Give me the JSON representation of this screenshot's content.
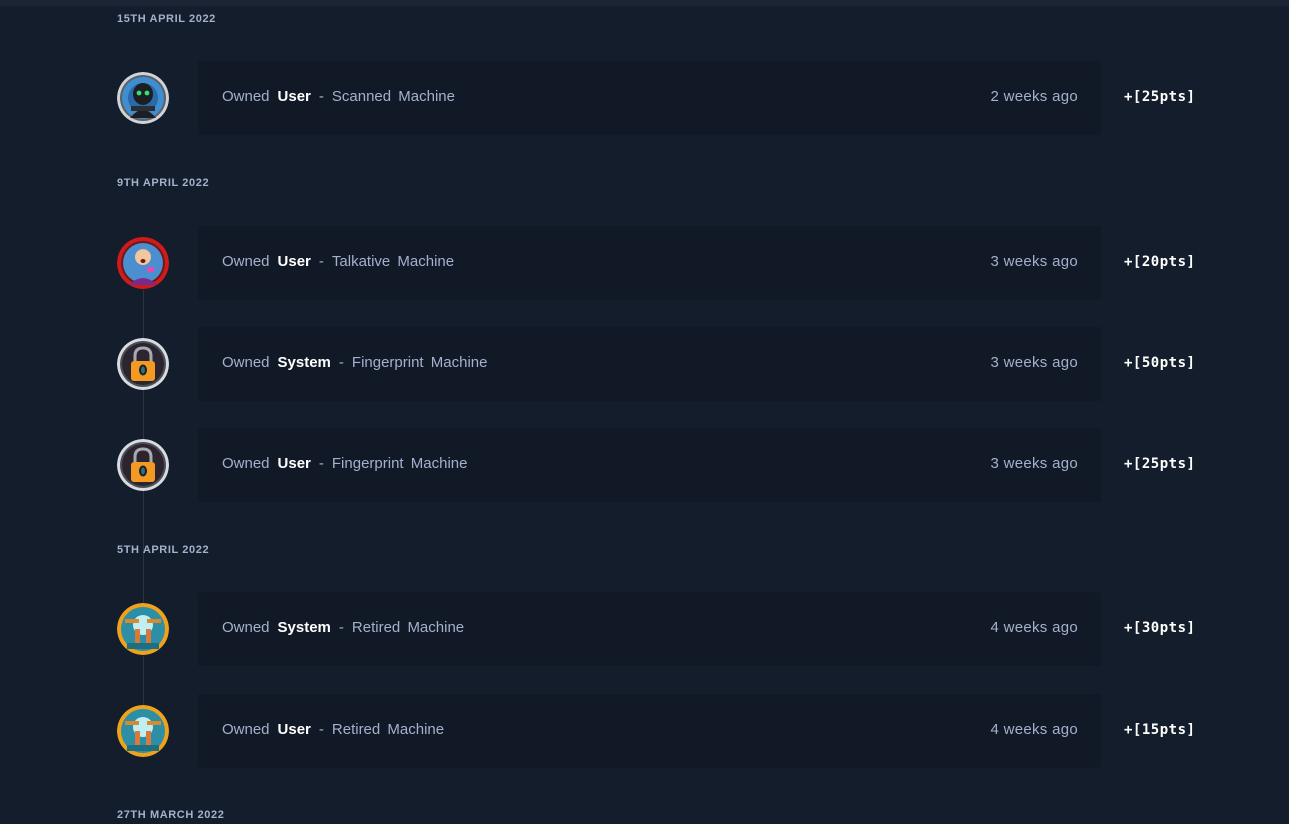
{
  "timeline": {
    "groups": [
      {
        "date": "15TH APRIL 2022",
        "items": [
          {
            "action": "Owned",
            "type": "User",
            "separator": "-",
            "machine": "Scanned",
            "suffix": "Machine",
            "time": "2 weeks ago",
            "points": "+[25pts]",
            "icon": "hooded-hacker-machine-icon"
          }
        ]
      },
      {
        "date": "9TH APRIL 2022",
        "items": [
          {
            "action": "Owned",
            "type": "User",
            "separator": "-",
            "machine": "Talkative",
            "suffix": "Machine",
            "time": "3 weeks ago",
            "points": "+[20pts]",
            "icon": "talking-person-machine-icon"
          },
          {
            "action": "Owned",
            "type": "System",
            "separator": "-",
            "machine": "Fingerprint",
            "suffix": "Machine",
            "time": "3 weeks ago",
            "points": "+[50pts]",
            "icon": "padlock-machine-icon"
          },
          {
            "action": "Owned",
            "type": "User",
            "separator": "-",
            "machine": "Fingerprint",
            "suffix": "Machine",
            "time": "3 weeks ago",
            "points": "+[25pts]",
            "icon": "padlock-machine-icon"
          }
        ]
      },
      {
        "date": "5TH APRIL 2022",
        "items": [
          {
            "action": "Owned",
            "type": "System",
            "separator": "-",
            "machine": "Retired",
            "suffix": "Machine",
            "time": "4 weeks ago",
            "points": "+[30pts]",
            "icon": "retired-sunset-machine-icon"
          },
          {
            "action": "Owned",
            "type": "User",
            "separator": "-",
            "machine": "Retired",
            "suffix": "Machine",
            "time": "4 weeks ago",
            "points": "+[15pts]",
            "icon": "retired-sunset-machine-icon"
          }
        ]
      },
      {
        "date": "27TH MARCH 2022",
        "items": []
      }
    ]
  },
  "colors": {
    "background": "#141d2b",
    "card": "#111927",
    "muted_text": "#a4b1cd",
    "bright_text": "#ffffff"
  }
}
